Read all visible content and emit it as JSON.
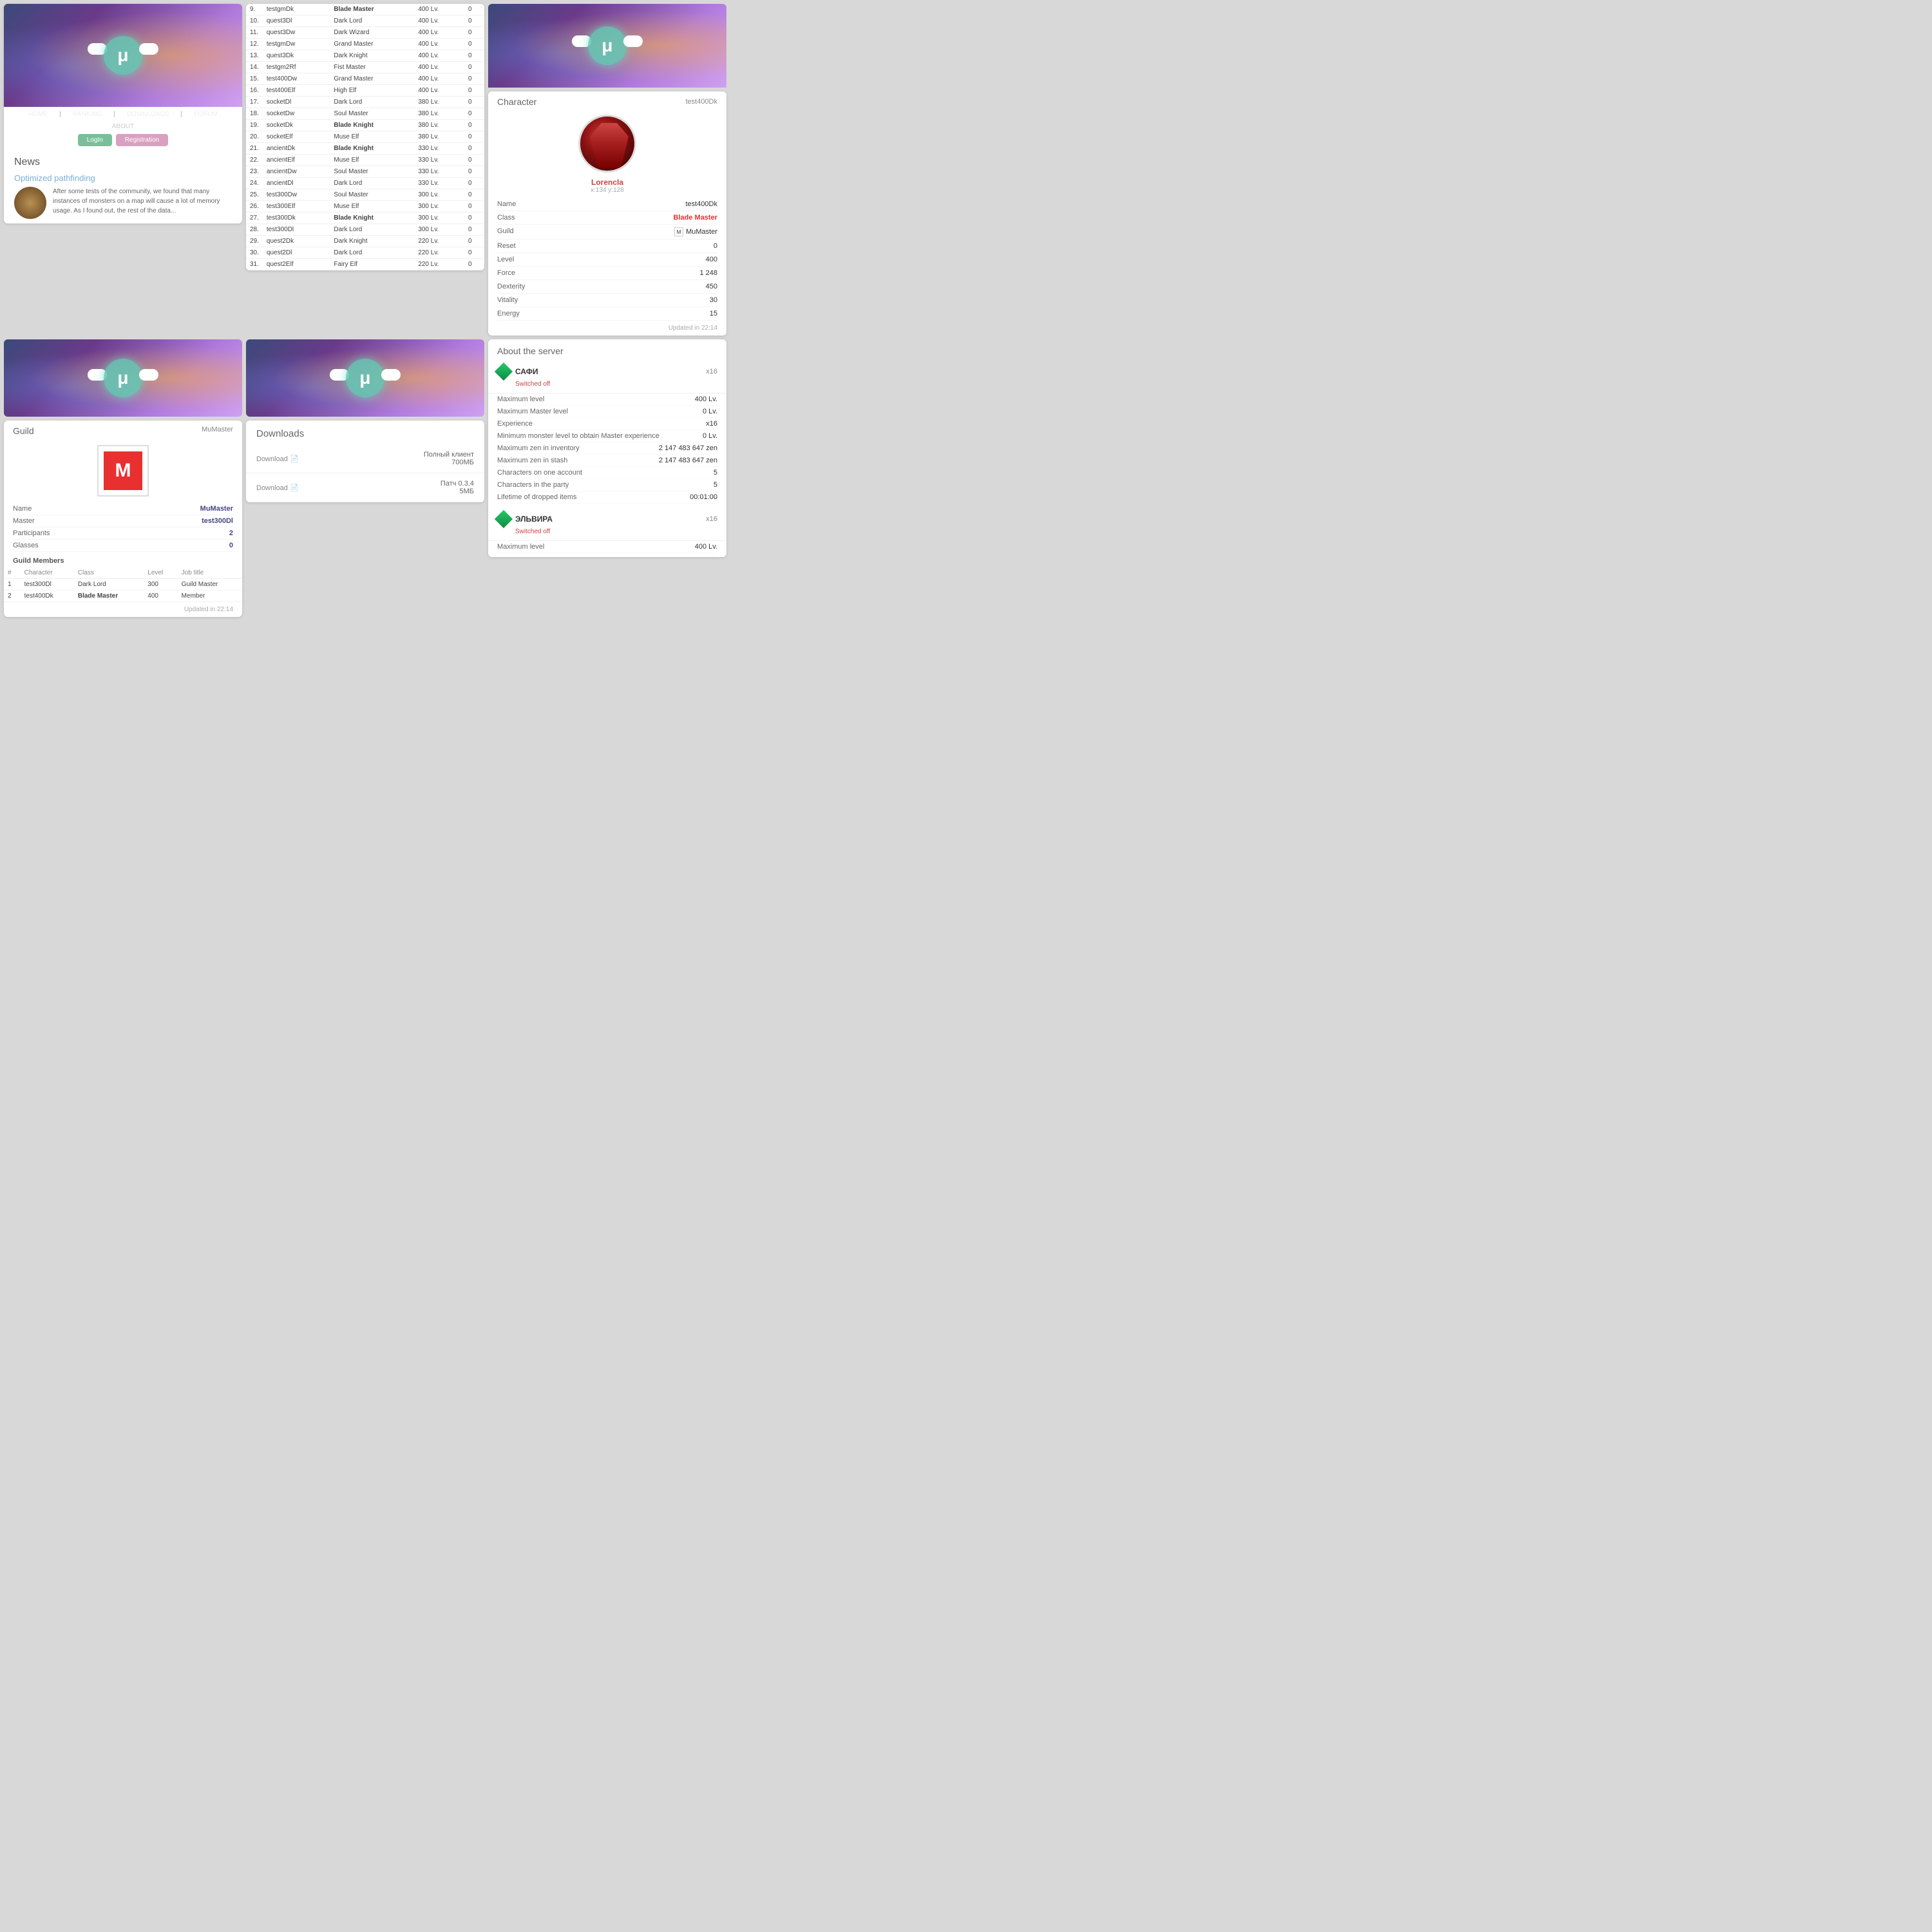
{
  "nav": {
    "items": [
      "HOME",
      "RANKING",
      "DOWNLOADS",
      "FORUM"
    ],
    "about": "ABOUT",
    "login": "LogIn",
    "register": "Registration"
  },
  "news": {
    "title": "News",
    "heading": "Optimized pathfinding",
    "text": "After some tests of the community, we found that many instances of monsters on a map will cause a lot of memory usage. As I found out, the rest of the data..."
  },
  "ranking": {
    "rows": [
      {
        "rank": "9.",
        "name": "testgmDk",
        "class": "Blade Master",
        "classKey": "bm",
        "level": "400 Lv.",
        "score": "0"
      },
      {
        "rank": "10.",
        "name": "quest3Dl",
        "class": "Dark Lord",
        "classKey": "dl",
        "level": "400 Lv.",
        "score": "0"
      },
      {
        "rank": "11.",
        "name": "quest3Dw",
        "class": "Dark Wizard",
        "classKey": "dw",
        "level": "400 Lv.",
        "score": "0"
      },
      {
        "rank": "12.",
        "name": "testgmDw",
        "class": "Grand Master",
        "classKey": "dl",
        "level": "400 Lv.",
        "score": "0"
      },
      {
        "rank": "13.",
        "name": "quest3Dk",
        "class": "Dark Knight",
        "classKey": "dk",
        "level": "400 Lv.",
        "score": "0"
      },
      {
        "rank": "14.",
        "name": "testgm2Rf",
        "class": "Fist Master",
        "classKey": "dl",
        "level": "400 Lv.",
        "score": "0"
      },
      {
        "rank": "15.",
        "name": "test400Dw",
        "class": "Grand Master",
        "classKey": "dl",
        "level": "400 Lv.",
        "score": "0"
      },
      {
        "rank": "16.",
        "name": "test400Elf",
        "class": "High Elf",
        "classKey": "dl",
        "level": "400 Lv.",
        "score": "0"
      },
      {
        "rank": "17.",
        "name": "socketDl",
        "class": "Dark Lord",
        "classKey": "dl",
        "level": "380 Lv.",
        "score": "0"
      },
      {
        "rank": "18.",
        "name": "socketDw",
        "class": "Soul Master",
        "classKey": "dl",
        "level": "380 Lv.",
        "score": "0"
      },
      {
        "rank": "19.",
        "name": "socketDk",
        "class": "Blade Knight",
        "classKey": "bk",
        "level": "380 Lv.",
        "score": "0"
      },
      {
        "rank": "20.",
        "name": "socketElf",
        "class": "Muse Elf",
        "classKey": "me",
        "level": "380 Lv.",
        "score": "0"
      },
      {
        "rank": "21.",
        "name": "ancientDk",
        "class": "Blade Knight",
        "classKey": "bk",
        "level": "330 Lv.",
        "score": "0"
      },
      {
        "rank": "22.",
        "name": "ancientElf",
        "class": "Muse Elf",
        "classKey": "me",
        "level": "330 Lv.",
        "score": "0"
      },
      {
        "rank": "23.",
        "name": "ancientDw",
        "class": "Soul Master",
        "classKey": "dl",
        "level": "330 Lv.",
        "score": "0"
      },
      {
        "rank": "24.",
        "name": "ancientDl",
        "class": "Dark Lord",
        "classKey": "dl",
        "level": "330 Lv.",
        "score": "0"
      },
      {
        "rank": "25.",
        "name": "test300Dw",
        "class": "Soul Master",
        "classKey": "dl",
        "level": "300 Lv.",
        "score": "0"
      },
      {
        "rank": "26.",
        "name": "test300Elf",
        "class": "Muse Elf",
        "classKey": "me",
        "level": "300 Lv.",
        "score": "0"
      },
      {
        "rank": "27.",
        "name": "test300Dk",
        "class": "Blade Knight",
        "classKey": "bk",
        "level": "300 Lv.",
        "score": "0"
      },
      {
        "rank": "28.",
        "name": "test300Dl",
        "class": "Dark Lord",
        "classKey": "dl",
        "level": "300 Lv.",
        "score": "0"
      },
      {
        "rank": "29.",
        "name": "quest2Dk",
        "class": "Dark Knight",
        "classKey": "dk",
        "level": "220 Lv.",
        "score": "0"
      },
      {
        "rank": "30.",
        "name": "quest2Dl",
        "class": "Dark Lord",
        "classKey": "dl",
        "level": "220 Lv.",
        "score": "0"
      },
      {
        "rank": "31.",
        "name": "quest2Elf",
        "class": "Fairy Elf",
        "classKey": "fe",
        "level": "220 Lv.",
        "score": "0"
      }
    ]
  },
  "character": {
    "title": "Character",
    "username": "test400Dk",
    "avatar_name": "LorencIa",
    "coords": "x:134  y:128",
    "stats": [
      {
        "label": "Name",
        "value": "test400Dk",
        "key": "name"
      },
      {
        "label": "Class",
        "value": "Blade Master",
        "key": "class"
      },
      {
        "label": "Guild",
        "value": "MuMaster",
        "key": "guild"
      },
      {
        "label": "Reset",
        "value": "0",
        "key": "reset"
      },
      {
        "label": "Level",
        "value": "400",
        "key": "level"
      },
      {
        "label": "Force",
        "value": "1 248",
        "key": "force"
      },
      {
        "label": "Dexterity",
        "value": "450",
        "key": "dexterity"
      },
      {
        "label": "Vitality",
        "value": "30",
        "key": "vitality"
      },
      {
        "label": "Energy",
        "value": "15",
        "key": "energy"
      }
    ],
    "updated": "Updated in 22:14"
  },
  "guild": {
    "title": "Guild",
    "guild_name": "MuMaster",
    "stats": [
      {
        "label": "Name",
        "value": "MuMaster"
      },
      {
        "label": "Master",
        "value": "test300Dl"
      },
      {
        "label": "Participants",
        "value": "2"
      },
      {
        "label": "Glasses",
        "value": "0"
      }
    ],
    "members_title": "Guild Members",
    "members_header": [
      "#",
      "Character",
      "Class",
      "Level",
      "Job title"
    ],
    "members": [
      {
        "num": "1",
        "name": "test300Dl",
        "class": "Dark Lord",
        "classKey": "dl",
        "level": "300",
        "job": "Guild Master"
      },
      {
        "num": "2",
        "name": "test400Dk",
        "class": "Blade Master",
        "classKey": "bm",
        "level": "400",
        "job": "Member"
      }
    ],
    "updated": "Updated in 22:14"
  },
  "downloads": {
    "title": "Downloads",
    "items": [
      {
        "link": "Download",
        "desc_line1": "Полный клиент",
        "desc_line2": "700МБ"
      },
      {
        "link": "Download",
        "desc_line1": "Патч 0.3.4",
        "desc_line2": "5МБ"
      }
    ]
  },
  "server": {
    "title": "About the server",
    "entries": [
      {
        "name": "САФИ",
        "multiplier": "x16",
        "status": "Switched off",
        "stats": [
          {
            "label": "Maximum level",
            "value": "400 Lv."
          },
          {
            "label": "Maximum Master level",
            "value": "0 Lv."
          },
          {
            "label": "Experience",
            "value": "x16"
          },
          {
            "label": "Minimum monster level to obtain Master experience",
            "value": "0 Lv."
          },
          {
            "label": "Maximum zen in inventory",
            "value": "2 147 483 647 zen"
          },
          {
            "label": "Maximum zen in stash",
            "value": "2 147 483 647 zen"
          },
          {
            "label": "Characters on one account",
            "value": "5"
          },
          {
            "label": "Characters in the party",
            "value": "5"
          },
          {
            "label": "Lifetime of dropped items",
            "value": "00:01:00"
          }
        ]
      },
      {
        "name": "ЭЛЬВИРА",
        "multiplier": "x16",
        "status": "Switched off",
        "stats": [
          {
            "label": "Maximum level",
            "value": "400 Lv."
          }
        ]
      }
    ]
  }
}
